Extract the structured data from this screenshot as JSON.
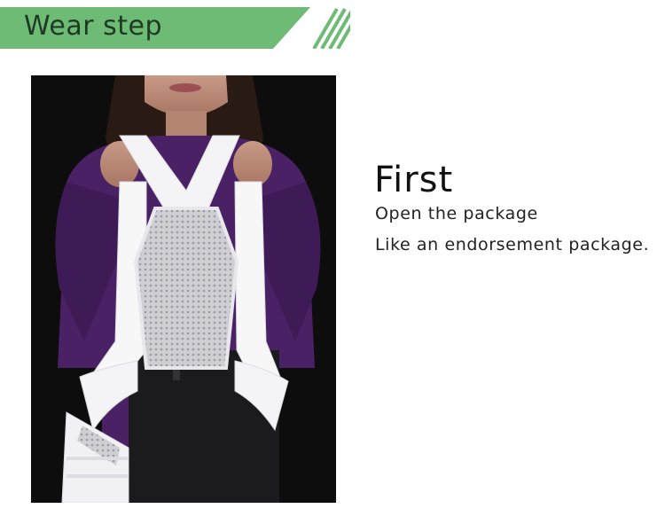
{
  "header": {
    "title": "Wear step",
    "accent_color": "#6dbb74"
  },
  "step": {
    "title": "First",
    "lines": [
      "Open the package",
      "Like an endorsement package."
    ]
  },
  "photo": {
    "icon": "person-holding-support-belt-image"
  }
}
